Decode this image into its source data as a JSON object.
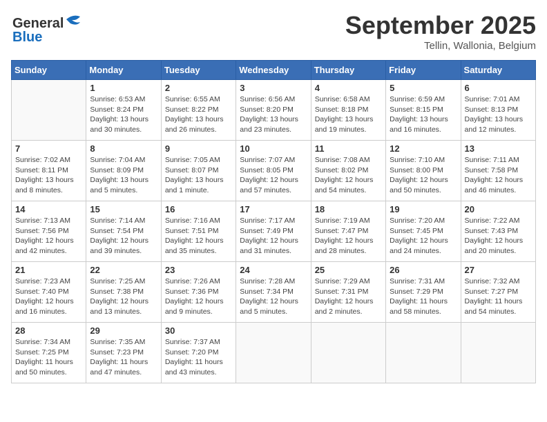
{
  "logo": {
    "line1": "General",
    "line2": "Blue"
  },
  "header": {
    "month": "September 2025",
    "location": "Tellin, Wallonia, Belgium"
  },
  "weekdays": [
    "Sunday",
    "Monday",
    "Tuesday",
    "Wednesday",
    "Thursday",
    "Friday",
    "Saturday"
  ],
  "weeks": [
    [
      {
        "day": "",
        "info": ""
      },
      {
        "day": "1",
        "info": "Sunrise: 6:53 AM\nSunset: 8:24 PM\nDaylight: 13 hours\nand 30 minutes."
      },
      {
        "day": "2",
        "info": "Sunrise: 6:55 AM\nSunset: 8:22 PM\nDaylight: 13 hours\nand 26 minutes."
      },
      {
        "day": "3",
        "info": "Sunrise: 6:56 AM\nSunset: 8:20 PM\nDaylight: 13 hours\nand 23 minutes."
      },
      {
        "day": "4",
        "info": "Sunrise: 6:58 AM\nSunset: 8:18 PM\nDaylight: 13 hours\nand 19 minutes."
      },
      {
        "day": "5",
        "info": "Sunrise: 6:59 AM\nSunset: 8:15 PM\nDaylight: 13 hours\nand 16 minutes."
      },
      {
        "day": "6",
        "info": "Sunrise: 7:01 AM\nSunset: 8:13 PM\nDaylight: 13 hours\nand 12 minutes."
      }
    ],
    [
      {
        "day": "7",
        "info": "Sunrise: 7:02 AM\nSunset: 8:11 PM\nDaylight: 13 hours\nand 8 minutes."
      },
      {
        "day": "8",
        "info": "Sunrise: 7:04 AM\nSunset: 8:09 PM\nDaylight: 13 hours\nand 5 minutes."
      },
      {
        "day": "9",
        "info": "Sunrise: 7:05 AM\nSunset: 8:07 PM\nDaylight: 13 hours\nand 1 minute."
      },
      {
        "day": "10",
        "info": "Sunrise: 7:07 AM\nSunset: 8:05 PM\nDaylight: 12 hours\nand 57 minutes."
      },
      {
        "day": "11",
        "info": "Sunrise: 7:08 AM\nSunset: 8:02 PM\nDaylight: 12 hours\nand 54 minutes."
      },
      {
        "day": "12",
        "info": "Sunrise: 7:10 AM\nSunset: 8:00 PM\nDaylight: 12 hours\nand 50 minutes."
      },
      {
        "day": "13",
        "info": "Sunrise: 7:11 AM\nSunset: 7:58 PM\nDaylight: 12 hours\nand 46 minutes."
      }
    ],
    [
      {
        "day": "14",
        "info": "Sunrise: 7:13 AM\nSunset: 7:56 PM\nDaylight: 12 hours\nand 42 minutes."
      },
      {
        "day": "15",
        "info": "Sunrise: 7:14 AM\nSunset: 7:54 PM\nDaylight: 12 hours\nand 39 minutes."
      },
      {
        "day": "16",
        "info": "Sunrise: 7:16 AM\nSunset: 7:51 PM\nDaylight: 12 hours\nand 35 minutes."
      },
      {
        "day": "17",
        "info": "Sunrise: 7:17 AM\nSunset: 7:49 PM\nDaylight: 12 hours\nand 31 minutes."
      },
      {
        "day": "18",
        "info": "Sunrise: 7:19 AM\nSunset: 7:47 PM\nDaylight: 12 hours\nand 28 minutes."
      },
      {
        "day": "19",
        "info": "Sunrise: 7:20 AM\nSunset: 7:45 PM\nDaylight: 12 hours\nand 24 minutes."
      },
      {
        "day": "20",
        "info": "Sunrise: 7:22 AM\nSunset: 7:43 PM\nDaylight: 12 hours\nand 20 minutes."
      }
    ],
    [
      {
        "day": "21",
        "info": "Sunrise: 7:23 AM\nSunset: 7:40 PM\nDaylight: 12 hours\nand 16 minutes."
      },
      {
        "day": "22",
        "info": "Sunrise: 7:25 AM\nSunset: 7:38 PM\nDaylight: 12 hours\nand 13 minutes."
      },
      {
        "day": "23",
        "info": "Sunrise: 7:26 AM\nSunset: 7:36 PM\nDaylight: 12 hours\nand 9 minutes."
      },
      {
        "day": "24",
        "info": "Sunrise: 7:28 AM\nSunset: 7:34 PM\nDaylight: 12 hours\nand 5 minutes."
      },
      {
        "day": "25",
        "info": "Sunrise: 7:29 AM\nSunset: 7:31 PM\nDaylight: 12 hours\nand 2 minutes."
      },
      {
        "day": "26",
        "info": "Sunrise: 7:31 AM\nSunset: 7:29 PM\nDaylight: 11 hours\nand 58 minutes."
      },
      {
        "day": "27",
        "info": "Sunrise: 7:32 AM\nSunset: 7:27 PM\nDaylight: 11 hours\nand 54 minutes."
      }
    ],
    [
      {
        "day": "28",
        "info": "Sunrise: 7:34 AM\nSunset: 7:25 PM\nDaylight: 11 hours\nand 50 minutes."
      },
      {
        "day": "29",
        "info": "Sunrise: 7:35 AM\nSunset: 7:23 PM\nDaylight: 11 hours\nand 47 minutes."
      },
      {
        "day": "30",
        "info": "Sunrise: 7:37 AM\nSunset: 7:20 PM\nDaylight: 11 hours\nand 43 minutes."
      },
      {
        "day": "",
        "info": ""
      },
      {
        "day": "",
        "info": ""
      },
      {
        "day": "",
        "info": ""
      },
      {
        "day": "",
        "info": ""
      }
    ]
  ]
}
